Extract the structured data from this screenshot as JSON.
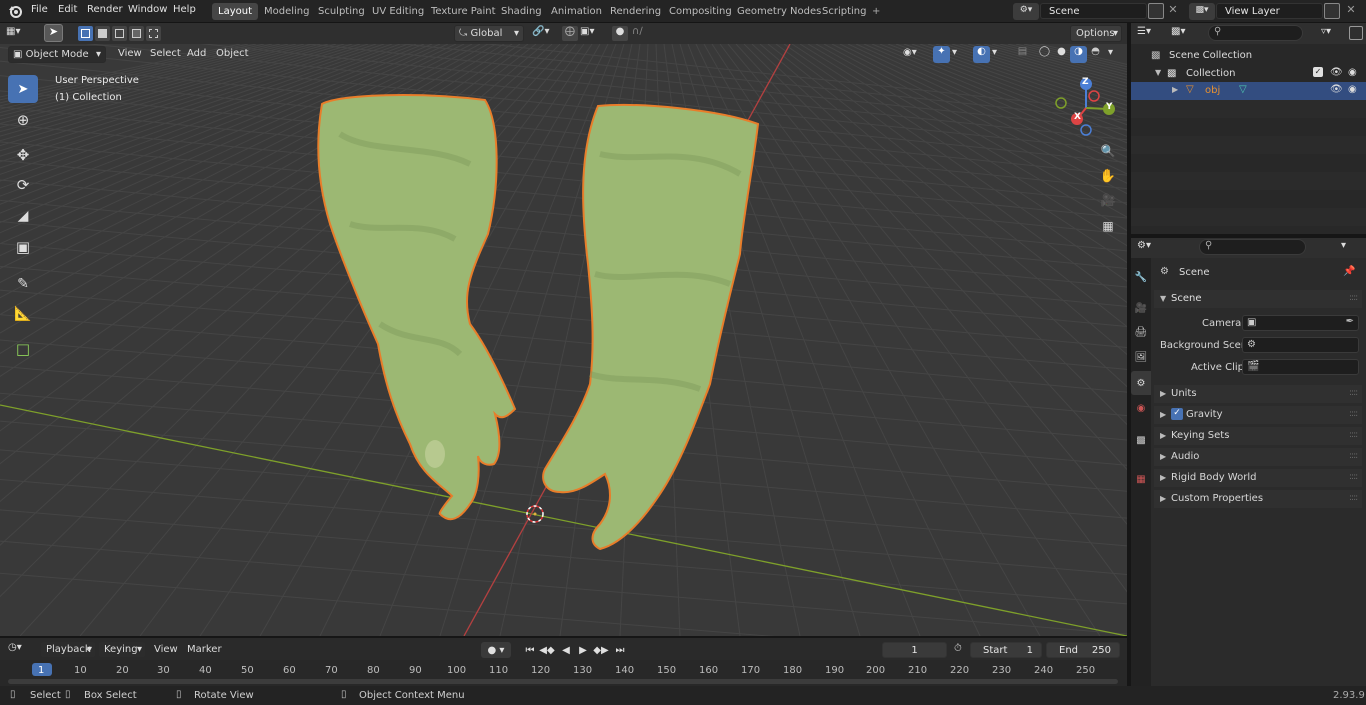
{
  "menu": {
    "file": "File",
    "edit": "Edit",
    "render": "Render",
    "window": "Window",
    "help": "Help"
  },
  "workspaces": [
    "Layout",
    "Modeling",
    "Sculpting",
    "UV Editing",
    "Texture Paint",
    "Shading",
    "Animation",
    "Rendering",
    "Compositing",
    "Geometry Nodes",
    "Scripting"
  ],
  "add_workspace": "+",
  "scene_field": "Scene",
  "view_layer_field": "View Layer",
  "viewport_header": {
    "mode": "Object Mode",
    "view": "View",
    "select": "Select",
    "add": "Add",
    "object": "Object",
    "transform": "Global",
    "options": "Options"
  },
  "viewport": {
    "perspective": "User Perspective",
    "collection": "(1) Collection"
  },
  "gizmo": {
    "x": "X",
    "y": "Y",
    "z": "Z"
  },
  "outliner": {
    "search_placeholder": "",
    "scene_collection": "Scene Collection",
    "collection": "Collection",
    "obj": "obj"
  },
  "properties": {
    "search_placeholder": "",
    "breadcrumb": "Scene",
    "panel": "Scene",
    "camera_label": "Camera",
    "bg_scene_label": "Background Scene",
    "active_clip_label": "Active Clip",
    "sections": [
      "Units",
      "Gravity",
      "Keying Sets",
      "Audio",
      "Rigid Body World",
      "Custom Properties"
    ]
  },
  "timeline": {
    "playback": "Playback",
    "keying": "Keying",
    "view": "View",
    "marker": "Marker",
    "current_frame": "1",
    "start_label": "Start",
    "start": "1",
    "end_label": "End",
    "end": "250",
    "ruler": [
      "1",
      "10",
      "20",
      "30",
      "40",
      "50",
      "60",
      "70",
      "80",
      "90",
      "100",
      "110",
      "120",
      "130",
      "140",
      "150",
      "160",
      "170",
      "180",
      "190",
      "200",
      "210",
      "220",
      "230",
      "240",
      "250"
    ]
  },
  "status": {
    "select": "Select",
    "box_select": "Box Select",
    "rotate": "Rotate View",
    "context": "Object Context Menu",
    "version": "2.93.9"
  },
  "colors": {
    "accent": "#4772b3",
    "outline": "#e87d2a",
    "mesh": "#9cb873",
    "grid": "#474747",
    "x_axis": "#b34040",
    "y_axis": "#7ea02a"
  }
}
